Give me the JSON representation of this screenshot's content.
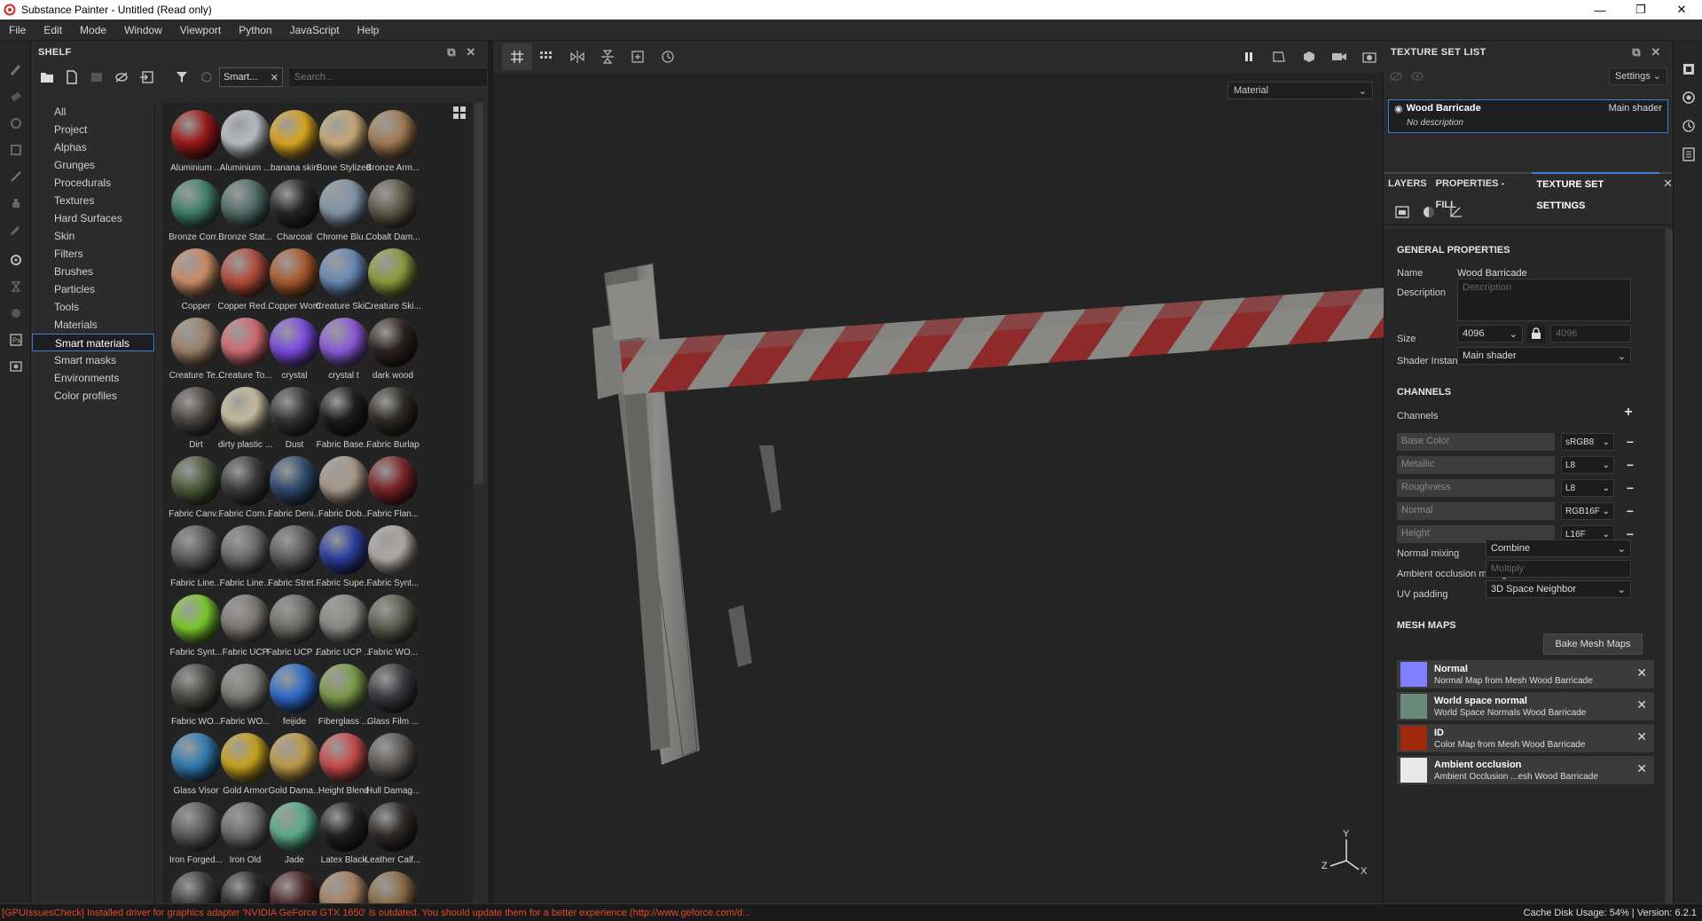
{
  "window": {
    "title": "Substance Painter - Untitled (Read only)",
    "minimize": "—",
    "maximize": "❐",
    "close": "✕"
  },
  "menu": [
    "File",
    "Edit",
    "Mode",
    "Window",
    "Viewport",
    "Python",
    "JavaScript",
    "Help"
  ],
  "shelf": {
    "title": "SHELF",
    "filter_tag": "Smart...",
    "search_placeholder": "Search...",
    "categories": [
      "All",
      "Project",
      "Alphas",
      "Grunges",
      "Procedurals",
      "Textures",
      "Hard Surfaces",
      "Skin",
      "Filters",
      "Brushes",
      "Particles",
      "Tools",
      "Materials",
      "Smart materials",
      "Smart masks",
      "Environments",
      "Color profiles"
    ],
    "selected_category": "Smart materials",
    "materials": [
      {
        "label": "Aluminium ...",
        "color": "#9a1616"
      },
      {
        "label": "Aluminium ...",
        "color": "#b8bcc2"
      },
      {
        "label": "banana skin",
        "color": "#d9a51f"
      },
      {
        "label": "Bone Stylized",
        "color": "#c8a876"
      },
      {
        "label": "Bronze Arm...",
        "color": "#a17a52"
      },
      {
        "label": "Bronze Corr...",
        "color": "#3f7f6a"
      },
      {
        "label": "Bronze Stat...",
        "color": "#4f6c66"
      },
      {
        "label": "Charcoal",
        "color": "#262626"
      },
      {
        "label": "Chrome Blu...",
        "color": "#8094a8"
      },
      {
        "label": "Cobalt Dam...",
        "color": "#5e5846"
      },
      {
        "label": "Copper",
        "color": "#c98a63"
      },
      {
        "label": "Copper Red...",
        "color": "#b24a3a"
      },
      {
        "label": "Copper Worn",
        "color": "#a85a2c"
      },
      {
        "label": "Creature Ski...",
        "color": "#6688b4"
      },
      {
        "label": "Creature Ski...",
        "color": "#8a9a3c"
      },
      {
        "label": "Creature Te...",
        "color": "#9a8068"
      },
      {
        "label": "Creature To...",
        "color": "#d06a72"
      },
      {
        "label": "crystal",
        "color": "#7a4ae0"
      },
      {
        "label": "crystal t",
        "color": "#8a5ad8"
      },
      {
        "label": "dark wood",
        "color": "#2e2220"
      },
      {
        "label": "Dirt",
        "color": "#4a4440"
      },
      {
        "label": "dirty plastic ...",
        "color": "#c8bca0"
      },
      {
        "label": "Dust",
        "color": "#333333"
      },
      {
        "label": "Fabric Base...",
        "color": "#1c1c1c"
      },
      {
        "label": "Fabric Burlap",
        "color": "#2e2a24"
      },
      {
        "label": "Fabric Canv...",
        "color": "#4a5a3a"
      },
      {
        "label": "Fabric Com...",
        "color": "#3a3a3c"
      },
      {
        "label": "Fabric Deni...",
        "color": "#2e4a6e"
      },
      {
        "label": "Fabric Dob...",
        "color": "#a8988a"
      },
      {
        "label": "Fabric Flan...",
        "color": "#7a2428"
      },
      {
        "label": "Fabric Line...",
        "color": "#5a5a5c"
      },
      {
        "label": "Fabric Line...",
        "color": "#6a6a6c"
      },
      {
        "label": "Fabric Stret...",
        "color": "#5c5c5e"
      },
      {
        "label": "Fabric Supe...",
        "color": "#2a3e9e"
      },
      {
        "label": "Fabric Synt...",
        "color": "#b0a8a4"
      },
      {
        "label": "Fabric Synt...",
        "color": "#7ac82e"
      },
      {
        "label": "Fabric UCP",
        "color": "#7a7672"
      },
      {
        "label": "Fabric UCP ...",
        "color": "#6e6c68"
      },
      {
        "label": "Fabric UCP ...",
        "color": "#8a8884"
      },
      {
        "label": "Fabric WO...",
        "color": "#5a5e4e"
      },
      {
        "label": "Fabric WO...",
        "color": "#4a4a44"
      },
      {
        "label": "Fabric WO...",
        "color": "#7a7874"
      },
      {
        "label": "feijide",
        "color": "#2e6ac8"
      },
      {
        "label": "Fiberglass ...",
        "color": "#7c9a4a"
      },
      {
        "label": "Glass Film ...",
        "color": "#3a3a40"
      },
      {
        "label": "Glass Visor",
        "color": "#2e7ab0"
      },
      {
        "label": "Gold Armor",
        "color": "#c8a21e"
      },
      {
        "label": "Gold Dama...",
        "color": "#c09a4a"
      },
      {
        "label": "Height Blend",
        "color": "#c84a4a"
      },
      {
        "label": "Hull Damag...",
        "color": "#5a5654"
      },
      {
        "label": "Iron Forged...",
        "color": "#5a5a5c"
      },
      {
        "label": "Iron Old",
        "color": "#6a6a6a"
      },
      {
        "label": "Jade",
        "color": "#5aaa88"
      },
      {
        "label": "Latex Black",
        "color": "#202020"
      },
      {
        "label": "Leather Calf...",
        "color": "#2e2a28"
      },
      {
        "label": "",
        "color": "#3a3a3a"
      },
      {
        "label": "",
        "color": "#2a2a2a"
      },
      {
        "label": "",
        "color": "#4a2424"
      },
      {
        "label": "",
        "color": "#a88060"
      },
      {
        "label": "",
        "color": "#8a6a44"
      }
    ]
  },
  "viewport": {
    "material_mode": "Material"
  },
  "texture_set_list": {
    "title": "TEXTURE SET LIST",
    "settings_label": "Settings",
    "item_name": "Wood Barricade",
    "item_shader": "Main shader",
    "item_desc": "No description"
  },
  "tabs": [
    "LAYERS",
    "PROPERTIES - FILL",
    "TEXTURE SET SETTINGS"
  ],
  "props": {
    "general_title": "GENERAL PROPERTIES",
    "name_label": "Name",
    "name_value": "Wood Barricade",
    "desc_label": "Description",
    "desc_placeholder": "Description",
    "size_label": "Size",
    "size_value": "4096",
    "size_value2": "4096",
    "shader_label": "Shader Instance",
    "shader_value": "Main shader",
    "channels_title": "CHANNELS",
    "channels_label": "Channels",
    "channels": [
      {
        "name": "Base Color",
        "format": "sRGB8"
      },
      {
        "name": "Metallic",
        "format": "L8"
      },
      {
        "name": "Roughness",
        "format": "L8"
      },
      {
        "name": "Normal",
        "format": "RGB16F"
      },
      {
        "name": "Height",
        "format": "L16F"
      }
    ],
    "normal_mixing_label": "Normal mixing",
    "normal_mixing_value": "Combine",
    "ao_mixing_label": "Ambient occlusion mixing",
    "ao_mixing_value": "Multiply",
    "uv_padding_label": "UV padding",
    "uv_padding_value": "3D Space Neighbor",
    "mesh_maps_title": "MESH MAPS",
    "bake_label": "Bake Mesh Maps",
    "mesh_maps": [
      {
        "title": "Normal",
        "desc": "Normal Map from Mesh Wood Barricade",
        "color": "#7f7fff"
      },
      {
        "title": "World space normal",
        "desc": "World Space Normals Wood Barricade",
        "color": "#6a8a7a"
      },
      {
        "title": "ID",
        "desc": "Color Map from Mesh Wood Barricade",
        "color": "#a02a10"
      },
      {
        "title": "Ambient occlusion",
        "desc": "Ambient Occlusion ...esh Wood Barricade",
        "color": "#e8e8e8"
      }
    ]
  },
  "status": {
    "message": "[GPUIssuesCheck] Installed driver for graphics adapter 'NVIDIA GeForce GTX 1650' is outdated. You should update them for a better experience (http://www.geforce.com/d...",
    "right": "Cache Disk Usage:   54% | Version: 6.2.1"
  },
  "gizmo": {
    "x": "X",
    "y": "Y",
    "z": "Z"
  }
}
